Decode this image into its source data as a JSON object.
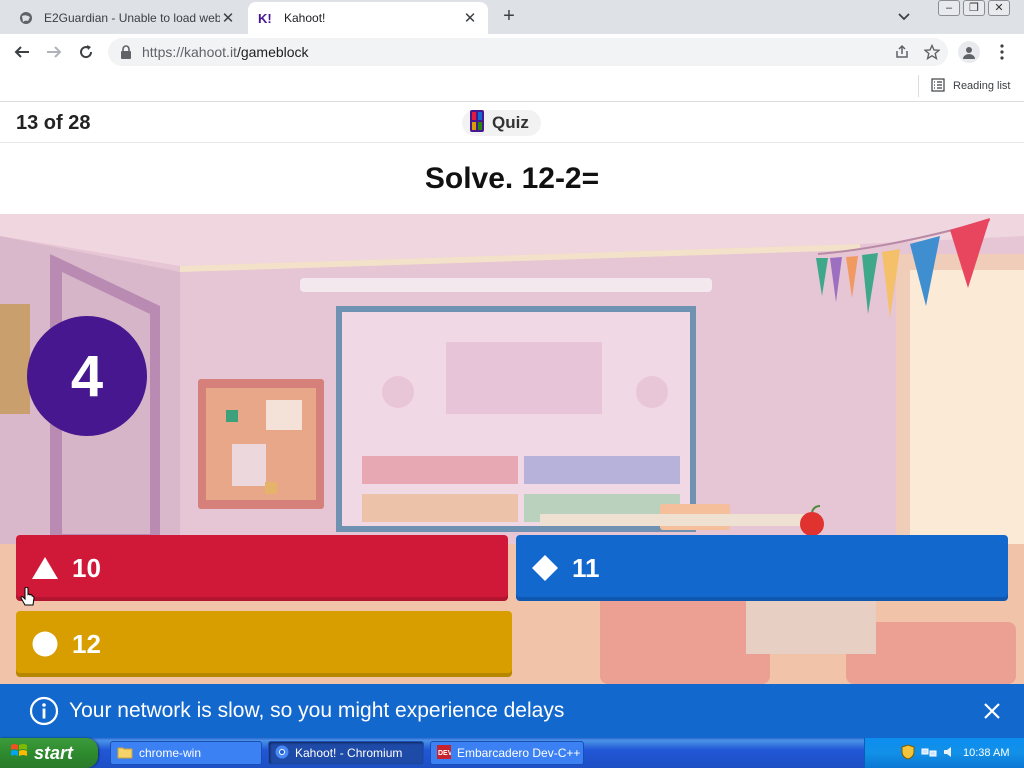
{
  "browser": {
    "tabs": [
      {
        "title": "E2Guardian - Unable to load website",
        "icon": "globe-icon",
        "active": false
      },
      {
        "title": "Kahoot!",
        "icon": "kahoot-favicon",
        "active": true
      }
    ],
    "url_host": "https://kahoot.it",
    "url_path": "/gameblock",
    "reading_list": "Reading list"
  },
  "game": {
    "progress": "13 of 28",
    "mode_label": "Quiz",
    "question": "Solve. 12-2=",
    "timer": "4",
    "answers": [
      {
        "text": "10",
        "shape": "triangle",
        "color": "#d01938"
      },
      {
        "text": "11",
        "shape": "diamond",
        "color": "#1368ce"
      },
      {
        "text": "12",
        "shape": "circle",
        "color": "#d89e00"
      }
    ],
    "network_notice": "Your network is slow, so you might experience delays"
  },
  "taskbar": {
    "start": "start",
    "tasks": [
      {
        "label": "chrome-win",
        "icon": "folder-icon",
        "active": false
      },
      {
        "label": "Kahoot! - Chromium",
        "icon": "chromium-icon",
        "active": true
      },
      {
        "label": "Embarcadero Dev-C++",
        "icon": "devcpp-icon",
        "active": false
      }
    ],
    "clock": "10:38 AM"
  }
}
